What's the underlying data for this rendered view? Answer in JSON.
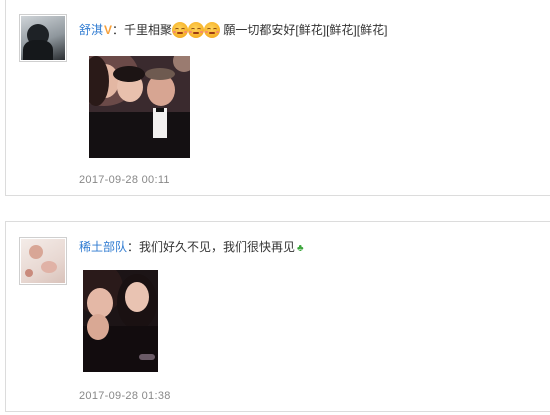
{
  "posts": [
    {
      "username": "舒淇",
      "badge": "V",
      "colon": "：",
      "text_a": "千里相聚",
      "emoji_name": "smiling-face-emoji",
      "text_b": " 願一切都安好[鲜花][鲜花][鲜花]",
      "timestamp": "2017-09-28 00:11"
    },
    {
      "username": "稀土部队",
      "colon": "：",
      "text": "我们好久不见，我们很快再见",
      "trailing_icon": "clover-icon",
      "timestamp": "2017-09-28 01:38"
    }
  ],
  "colors": {
    "username": "#2f7bd1",
    "badge": "#f7a13c",
    "timestamp": "#888888",
    "border": "#dcdcdc"
  }
}
